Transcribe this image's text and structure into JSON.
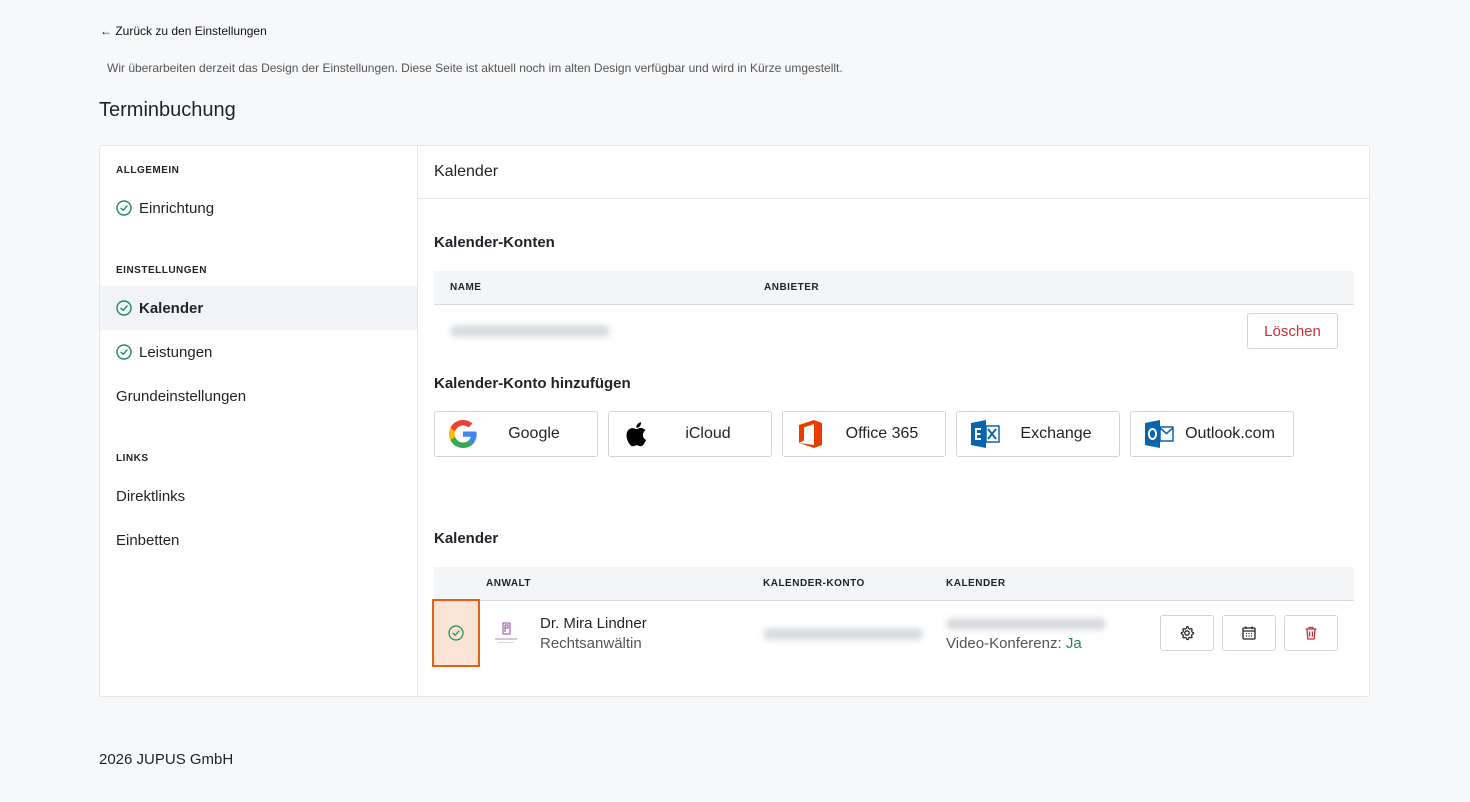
{
  "back_link": "← Zurück zu den Einstellungen",
  "notice": "Wir überarbeiten derzeit das Design der Einstellungen. Diese Seite ist aktuell noch im alten Design verfügbar und wird in Kürze umgestellt.",
  "page_title": "Terminbuchung",
  "sidebar": {
    "general_label": "ALLGEMEIN",
    "setup": "Einrichtung",
    "settings_label": "EINSTELLUNGEN",
    "calendar": "Kalender",
    "services": "Leistungen",
    "basic": "Grundeinstellungen",
    "links_label": "LINKS",
    "direct_links": "Direktlinks",
    "embed": "Einbetten"
  },
  "main": {
    "header": "Kalender",
    "accounts_title": "Kalender-Konten",
    "accounts_cols": {
      "name": "NAME",
      "provider": "ANBIETER"
    },
    "delete_button": "Löschen",
    "add_title": "Kalender-Konto hinzufügen",
    "providers": [
      {
        "label": "Google",
        "icon": "google-icon"
      },
      {
        "label": "iCloud",
        "icon": "apple-icon"
      },
      {
        "label": "Office 365",
        "icon": "office-icon"
      },
      {
        "label": "Exchange",
        "icon": "exchange-icon"
      },
      {
        "label": "Outlook.com",
        "icon": "outlook-icon"
      }
    ],
    "calendars_title": "Kalender",
    "calendar_cols": {
      "lawyer": "ANWALT",
      "account": "KALENDER-KONTO",
      "calendar": "KALENDER"
    },
    "calendar_row": {
      "name": "Dr. Mira Lindner",
      "role": "Rechtsanwältin",
      "video_label": "Video-Konferenz:",
      "video_value": "Ja"
    }
  },
  "footer": "2026 JUPUS GmbH",
  "colors": {
    "success": "#1e8a5a",
    "danger": "#c9303a",
    "highlight_border": "#e0621a",
    "highlight_bg": "#fbe3d6"
  }
}
